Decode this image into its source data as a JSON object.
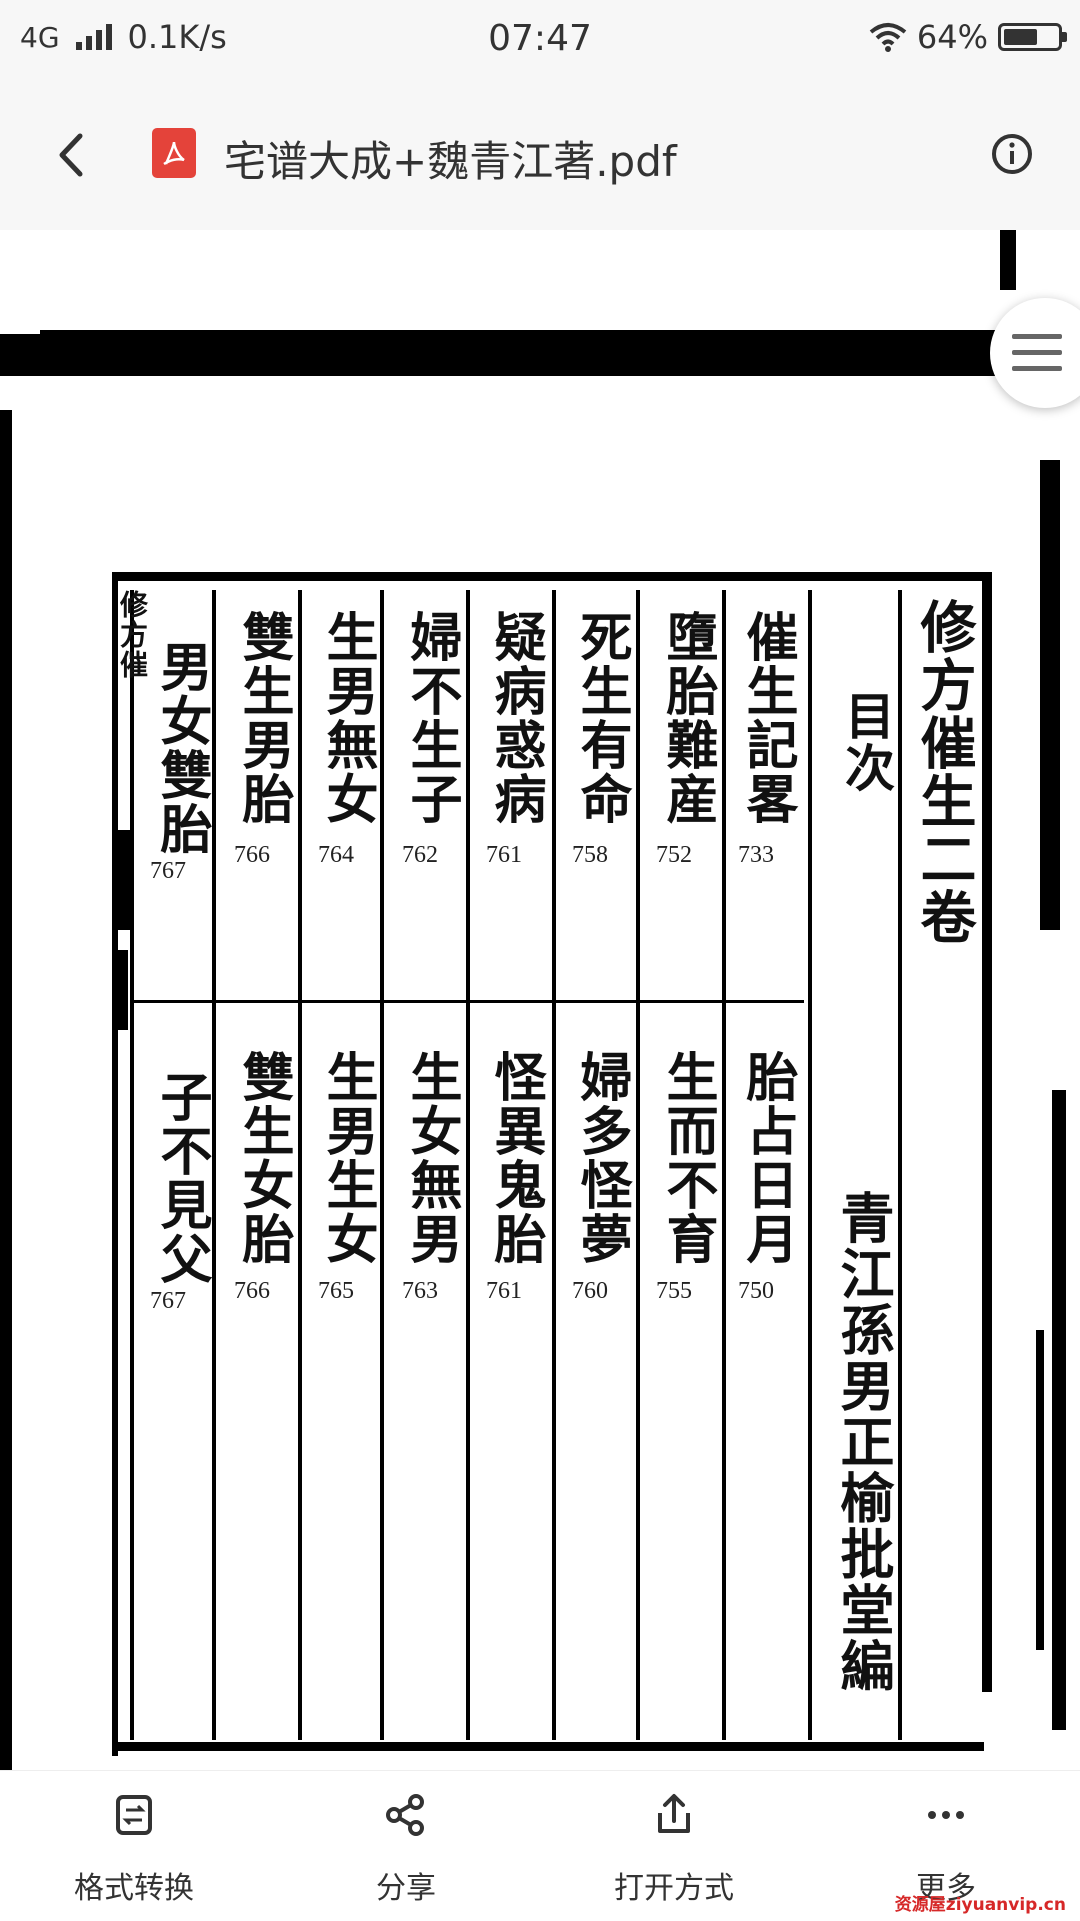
{
  "status_bar": {
    "network": "4G",
    "speed": "0.1K/s",
    "time": "07:47",
    "battery": "64%",
    "battery_level": 0.64,
    "icons": [
      "signal-icon",
      "wifi-icon",
      "battery-icon"
    ]
  },
  "title_bar": {
    "title": "宅谱大成+魏青江著.pdf",
    "icons": [
      "back-icon",
      "pdf-file-icon",
      "info-icon"
    ]
  },
  "page": {
    "header": "修方催生二卷",
    "subheader": "目次",
    "author": "青江孫男正榆批堂編",
    "spine": "修方催",
    "entries": [
      {
        "top": "催生記畧",
        "top_page": "733",
        "bottom": "胎占日月",
        "bottom_page": "750"
      },
      {
        "top": "墮胎難産",
        "top_page": "752",
        "bottom": "生而不育",
        "bottom_page": "755"
      },
      {
        "top": "死生有命",
        "top_page": "758",
        "bottom": "婦多怪夢",
        "bottom_page": "760"
      },
      {
        "top": "疑病惑病",
        "top_page": "761",
        "bottom": "怪異鬼胎",
        "bottom_page": "761"
      },
      {
        "top": "婦不生子",
        "top_page": "762",
        "bottom": "生女無男",
        "bottom_page": "763"
      },
      {
        "top": "生男無女",
        "top_page": "764",
        "bottom": "生男生女",
        "bottom_page": "765"
      },
      {
        "top": "雙生男胎",
        "top_page": "766",
        "bottom": "雙生女胎",
        "bottom_page": "766"
      },
      {
        "top": "男女雙胎",
        "top_page": "767",
        "bottom": "子不見父",
        "bottom_page": "767"
      }
    ]
  },
  "floating_button": {
    "icon": "menu-icon"
  },
  "toolbar": {
    "items": [
      {
        "label": "格式转换",
        "icon": "convert-icon"
      },
      {
        "label": "分享",
        "icon": "share-icon"
      },
      {
        "label": "打开方式",
        "icon": "open-with-icon"
      },
      {
        "label": "更多",
        "icon": "more-icon"
      }
    ]
  },
  "watermark": "资源屋ziyuanvip.cn"
}
